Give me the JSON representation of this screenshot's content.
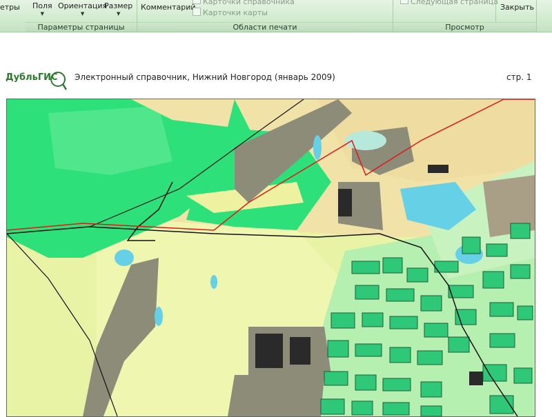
{
  "ribbon": {
    "partial_left_label": "етры",
    "groups": [
      {
        "caption": "Параметры страницы",
        "buttons": [
          "Поля",
          "Ориентация",
          "Размер"
        ]
      },
      {
        "caption": "Области печати",
        "button": "Комментарий",
        "checkbox_clipped": "Карточки справочника",
        "checkbox": "Карточки карты"
      },
      {
        "caption": "Просмотр",
        "clipped_label": "Следующая страница",
        "close_label": "Закрыть"
      }
    ]
  },
  "page": {
    "logo_text": "ДубльГИС",
    "header_title": "Электронный справочник, Нижний Новгород (январь 2009)",
    "page_number": "стр. 1"
  },
  "colors": {
    "ribbon_bg": "#d2ecd0",
    "map_green": "#2ee07a",
    "map_light": "#e8f3a6",
    "map_sand": "#f1e2a8",
    "map_water": "#65d0e6",
    "map_built": "#8c8c78",
    "map_road_red": "#e01818"
  },
  "icons": [
    "logo-magnifier-icon",
    "checkbox-icon",
    "dropdown-arrow-icon"
  ]
}
